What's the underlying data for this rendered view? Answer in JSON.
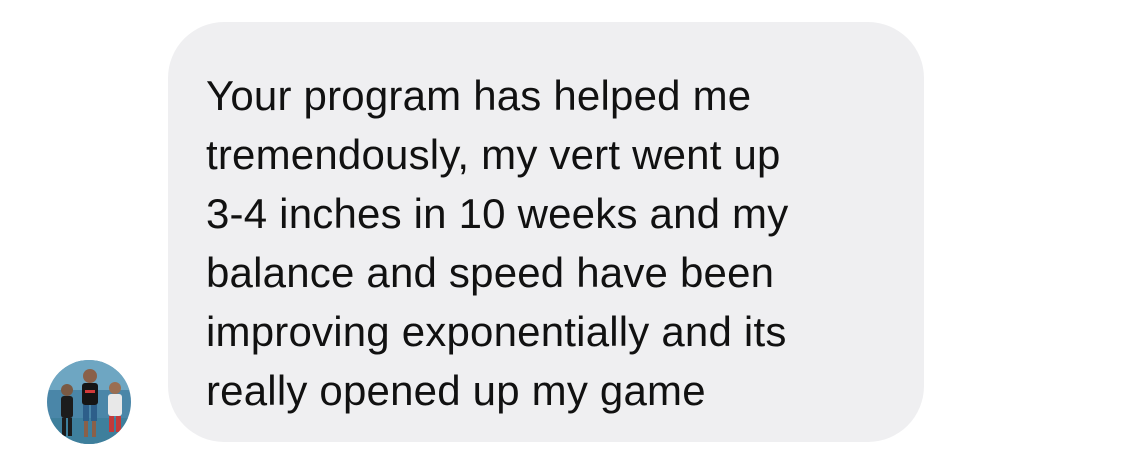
{
  "message": {
    "lines": [
      "Your program has helped me",
      "tremendously, my vert went up",
      "3-4 inches in 10 weeks and my",
      "balance and speed have been",
      "improving exponentially and its",
      "really opened up my game"
    ]
  },
  "avatar": {
    "icon": "profile-photo"
  },
  "colors": {
    "bubble_background": "#efeff1",
    "text": "#111111",
    "page_background": "#ffffff"
  }
}
